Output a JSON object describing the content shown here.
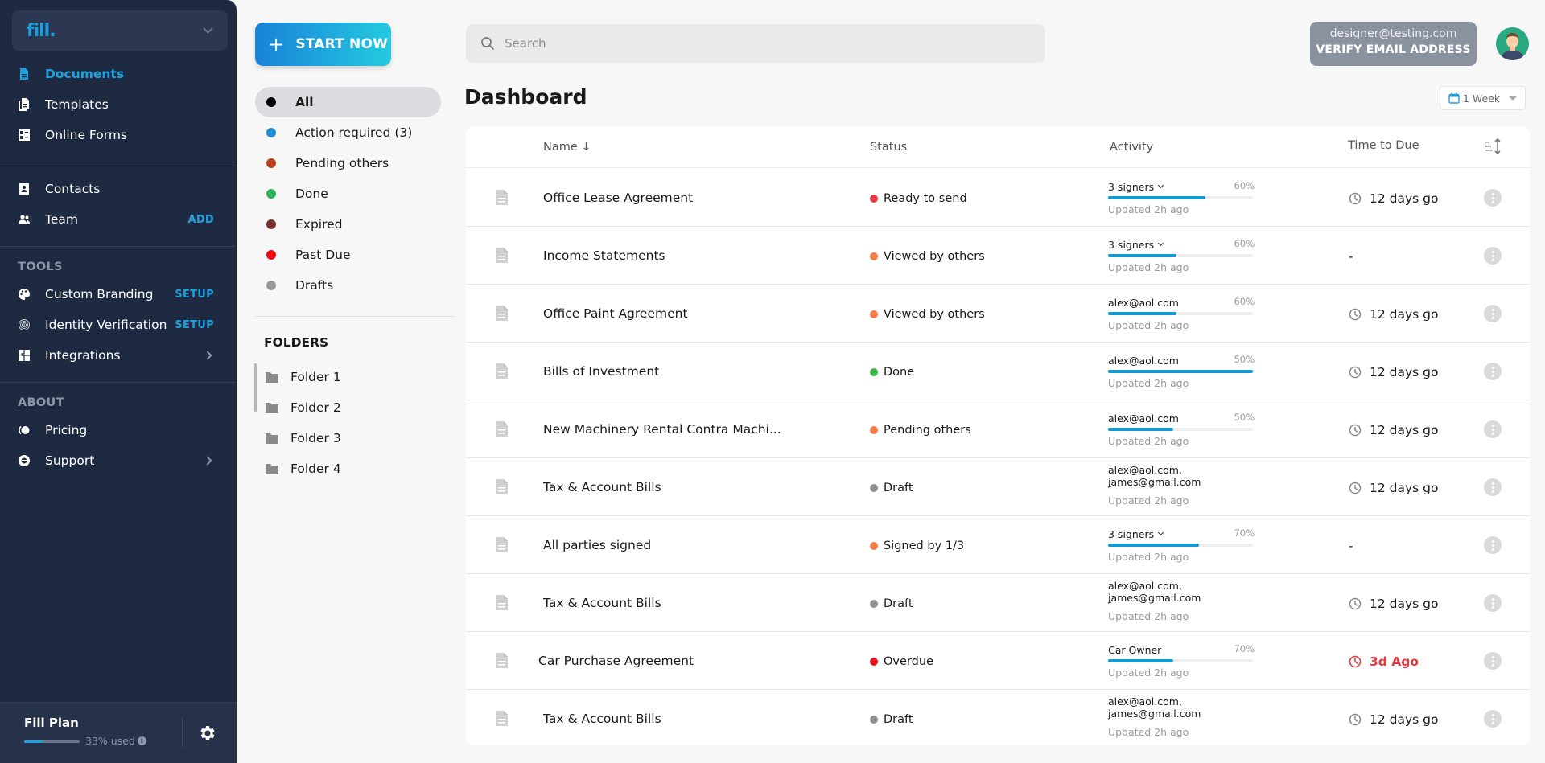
{
  "brand": {
    "logo": "fill."
  },
  "sidebar": {
    "main": [
      {
        "label": "Documents",
        "icon": "document-icon",
        "active": true
      },
      {
        "label": "Templates",
        "icon": "templates-icon"
      },
      {
        "label": "Online Forms",
        "icon": "forms-icon"
      }
    ],
    "people": [
      {
        "label": "Contacts",
        "icon": "contacts-icon"
      },
      {
        "label": "Team",
        "icon": "team-icon",
        "tag": "ADD"
      }
    ],
    "tools_heading": "TOOLS",
    "tools": [
      {
        "label": "Custom Branding",
        "icon": "palette-icon",
        "tag": "SETUP"
      },
      {
        "label": "Identity Verification",
        "icon": "fingerprint-icon",
        "tag": "SETUP"
      },
      {
        "label": "Integrations",
        "icon": "puzzle-icon",
        "chevron": true
      }
    ],
    "about_heading": "ABOUT",
    "about": [
      {
        "label": "Pricing",
        "icon": "pricing-icon"
      },
      {
        "label": "Support",
        "icon": "support-icon",
        "chevron": true
      }
    ],
    "plan": {
      "title": "Fill Plan",
      "used_label": "33% used",
      "used_fraction": 0.33
    }
  },
  "start_button": {
    "label": "START NOW"
  },
  "filters": [
    {
      "label": "All",
      "color": "#000000",
      "active": true
    },
    {
      "label": "Action required (3)",
      "color": "#1f8fd6"
    },
    {
      "label": "Pending others",
      "color": "#b8431e"
    },
    {
      "label": "Done",
      "color": "#2fb35a"
    },
    {
      "label": "Expired",
      "color": "#7a3030"
    },
    {
      "label": "Past Due",
      "color": "#f00a14"
    },
    {
      "label": "Drafts",
      "color": "#999999"
    }
  ],
  "folders": {
    "heading": "FOLDERS",
    "items": [
      "Folder 1",
      "Folder 2",
      "Folder 3",
      "Folder 4"
    ]
  },
  "search": {
    "placeholder": "Search",
    "value": ""
  },
  "account": {
    "email": "designer@testing.com",
    "verify_label": "VERIFY EMAIL ADDRESS"
  },
  "page": {
    "title": "Dashboard",
    "range_label": "1 Week"
  },
  "table": {
    "columns": {
      "name": "Name ↓",
      "status": "Status",
      "activity": "Activity",
      "due": "Time to Due"
    },
    "rows": [
      {
        "name": "Office Lease Agreement",
        "status": "Ready to send",
        "status_color": "#e03a3e",
        "activity_top": "3 signers",
        "dropdown": true,
        "percent_label": "60%",
        "progress": 0.67,
        "updated": "Updated 2h ago",
        "due": "12 days go",
        "due_icon": true
      },
      {
        "name": "Income Statements",
        "status": "Viewed by others",
        "status_color": "#f47c45",
        "activity_top": "3 signers",
        "dropdown": true,
        "percent_label": "60%",
        "progress": 0.47,
        "updated": "Updated 2h ago",
        "due": "-",
        "due_icon": false
      },
      {
        "name": "Office Paint Agreement",
        "status": "Viewed by others",
        "status_color": "#f47c45",
        "activity_top": "alex@aol.com",
        "percent_label": "60%",
        "progress": 0.47,
        "updated": "Updated 2h ago",
        "due": "12 days go",
        "due_icon": true
      },
      {
        "name": "Bills of Investment",
        "status": "Done",
        "status_color": "#3bb54a",
        "activity_top": "alex@aol.com",
        "percent_label": "50%",
        "progress": 1.0,
        "updated": "Updated 2h ago",
        "due": "12 days go",
        "due_icon": true
      },
      {
        "name": "New Machinery Rental Contra Machi...",
        "status": "Pending others",
        "status_color": "#f47c45",
        "activity_top": "alex@aol.com",
        "percent_label": "50%",
        "progress": 0.45,
        "updated": "Updated 2h ago",
        "due": "12 days go",
        "due_icon": true
      },
      {
        "name": "Tax & Account Bills",
        "status": "Draft",
        "status_color": "#8f8f8f",
        "activity_top": "alex@aol.com, james@gmail.com",
        "dash": "-",
        "updated": "Updated 2h ago",
        "due": "12 days go",
        "due_icon": true
      },
      {
        "name": "All parties signed",
        "status": "Signed by 1/3",
        "status_color": "#f47c45",
        "activity_top": "3 signers",
        "dropdown": true,
        "percent_label": "70%",
        "progress": 0.63,
        "updated": "Updated 2h ago",
        "due": "-",
        "due_icon": false
      },
      {
        "name": "Tax & Account Bills",
        "status": "Draft",
        "status_color": "#8f8f8f",
        "activity_top": "alex@aol.com, james@gmail.com",
        "dash": "-",
        "updated": "Updated 2h ago",
        "due": "12 days go",
        "due_icon": true
      },
      {
        "name": "Car Purchase Agreement",
        "status": "Overdue",
        "status_color": "#e8141c",
        "activity_top": "Car Owner",
        "percent_label": "70%",
        "progress": 0.45,
        "updated": "Updated 2h ago",
        "due": "3d Ago",
        "due_icon": true,
        "overdue": true
      },
      {
        "name": "Tax & Account Bills",
        "status": "Draft",
        "status_color": "#8f8f8f",
        "activity_top": "alex@aol.com, james@gmail.com",
        "dash": " ",
        "updated": "Updated 2h ago",
        "due": "12 days go",
        "due_icon": true
      }
    ]
  },
  "colors": {
    "accent": "#1fa0dd",
    "sidebar_bg": "#1e2a42",
    "progress": "#1499d4",
    "overdue": "#e0393e"
  }
}
